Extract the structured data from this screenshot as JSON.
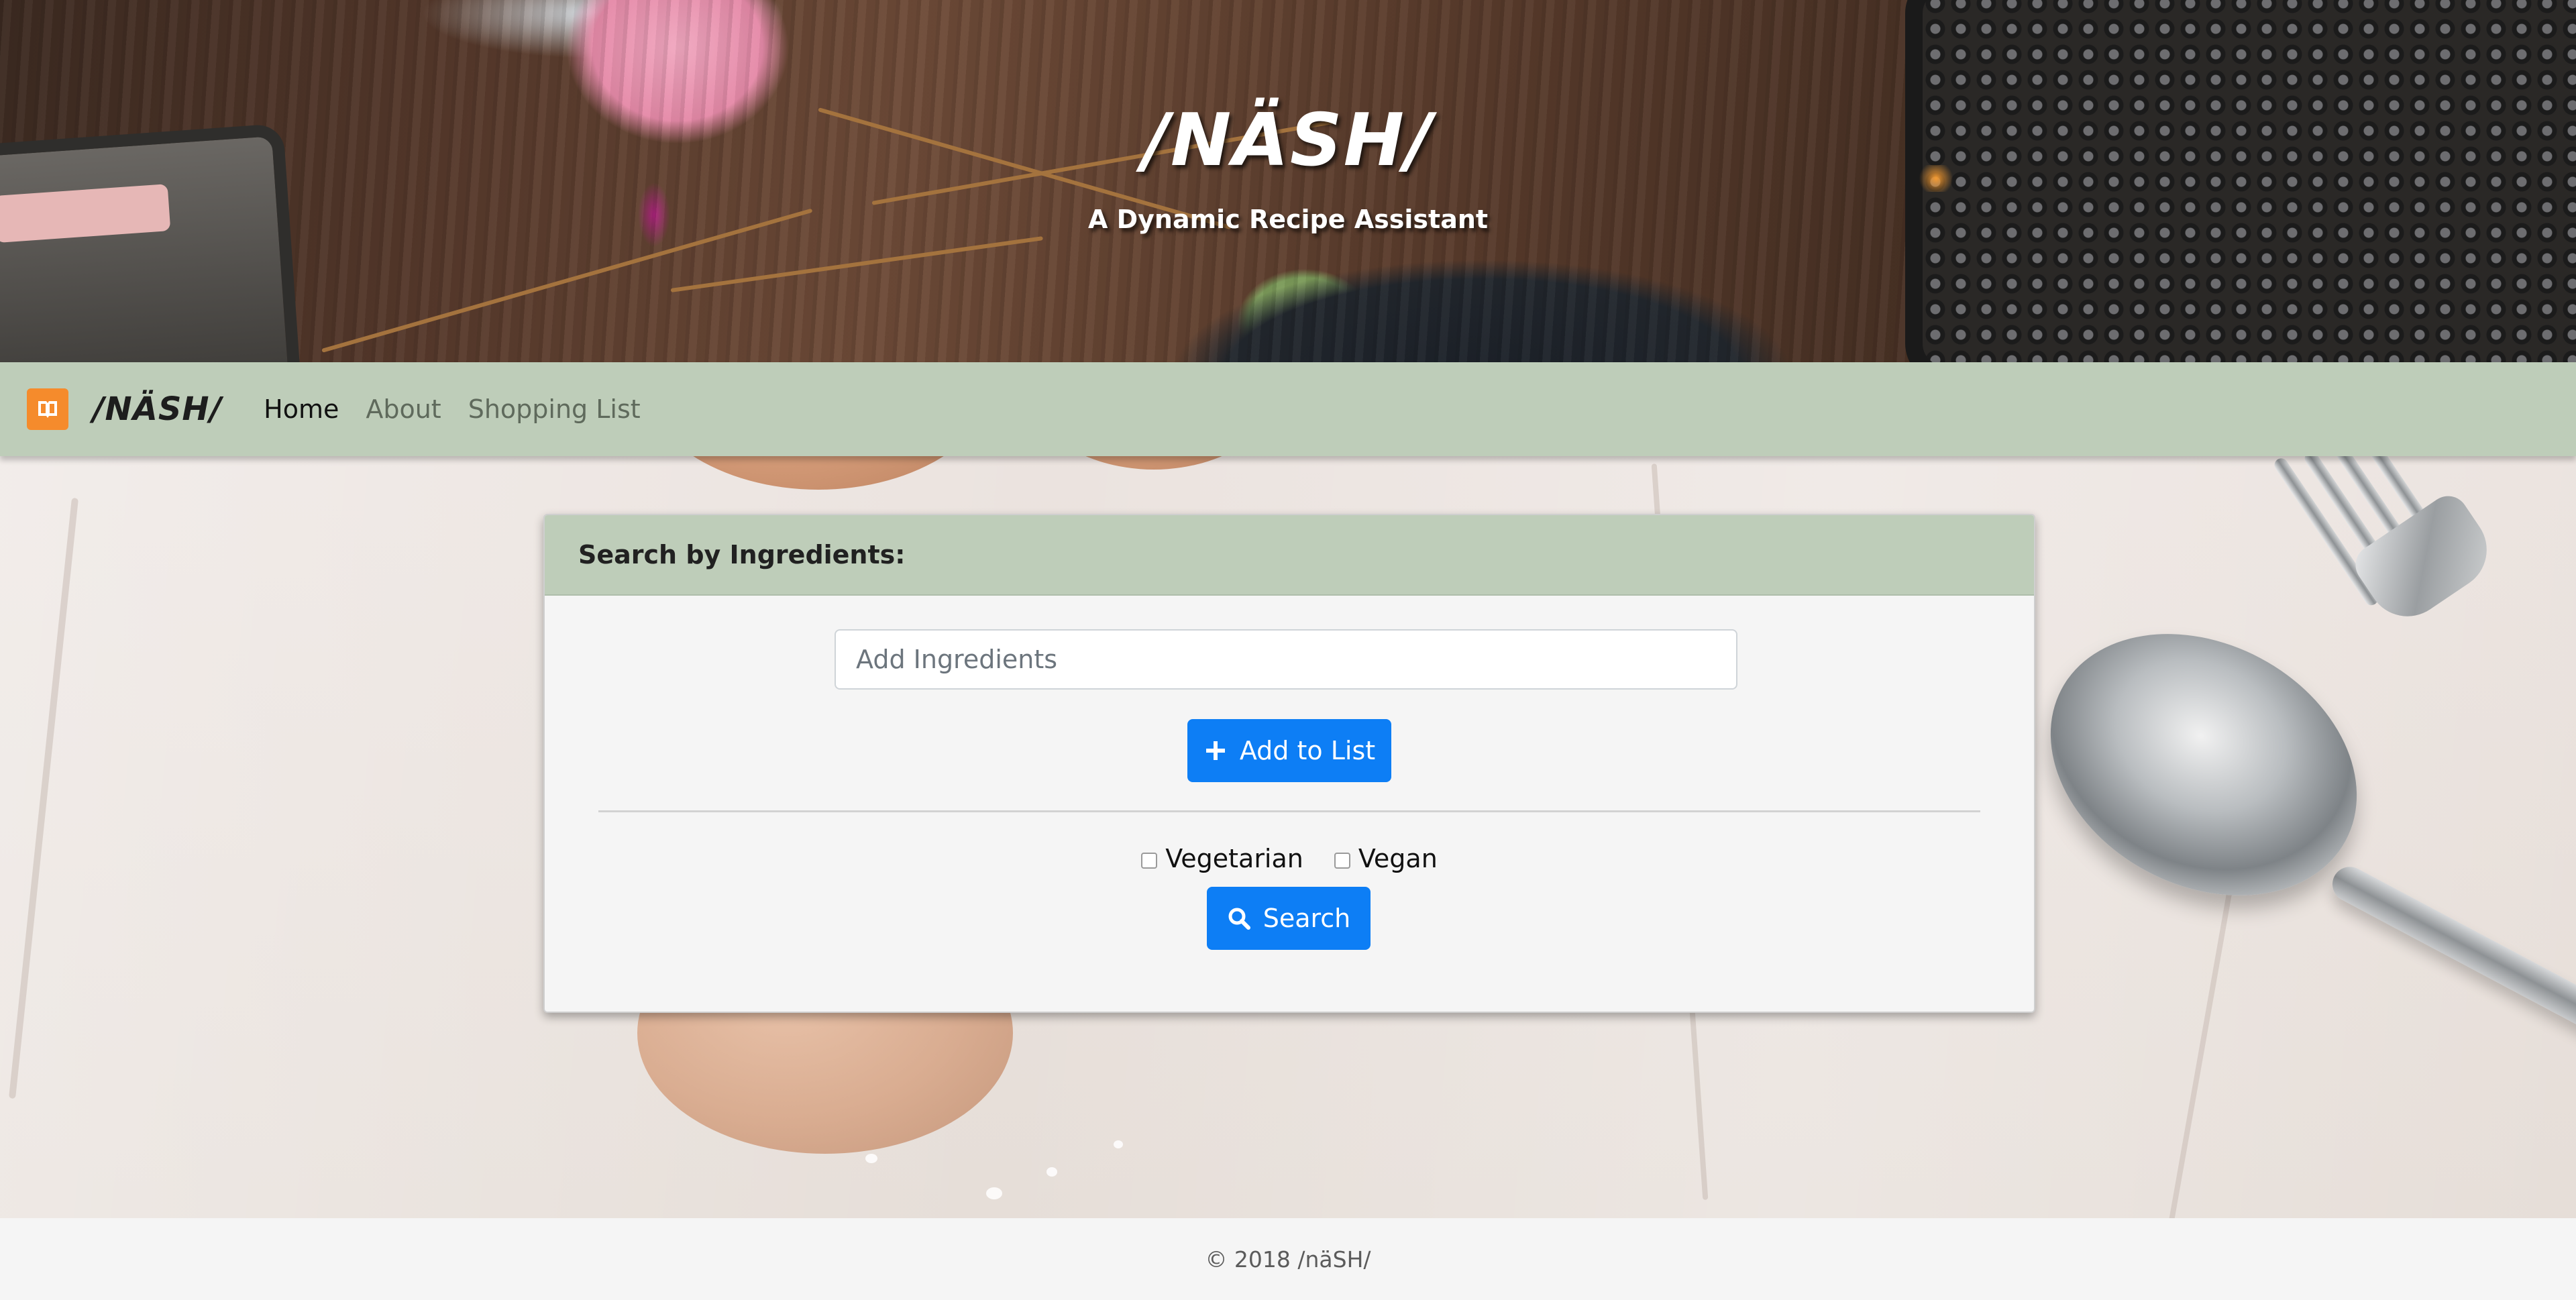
{
  "hero": {
    "title": "/NÄSH/",
    "subtitle": "A Dynamic Recipe Assistant"
  },
  "navbar": {
    "brand_icon": "book-icon",
    "brand_name": "/NÄSH/",
    "items": [
      {
        "label": "Home",
        "active": true
      },
      {
        "label": "About",
        "active": false
      },
      {
        "label": "Shopping List",
        "active": false
      }
    ]
  },
  "card": {
    "header": "Search by Ingredients:",
    "ingredient_input": {
      "value": "",
      "placeholder": "Add Ingredients"
    },
    "add_button": {
      "label": "Add to List",
      "icon": "plus-icon"
    },
    "filters": [
      {
        "label": "Vegetarian",
        "checked": false
      },
      {
        "label": "Vegan",
        "checked": false
      }
    ],
    "search_button": {
      "label": "Search",
      "icon": "search-icon"
    }
  },
  "footer": {
    "text": "© 2018 /näSH/"
  },
  "colors": {
    "navbar_bg": "#becdb9",
    "primary_button": "#0d7ef5",
    "brand_icon_bg": "#f58b2c",
    "footer_bg": "#f5f5f5"
  }
}
